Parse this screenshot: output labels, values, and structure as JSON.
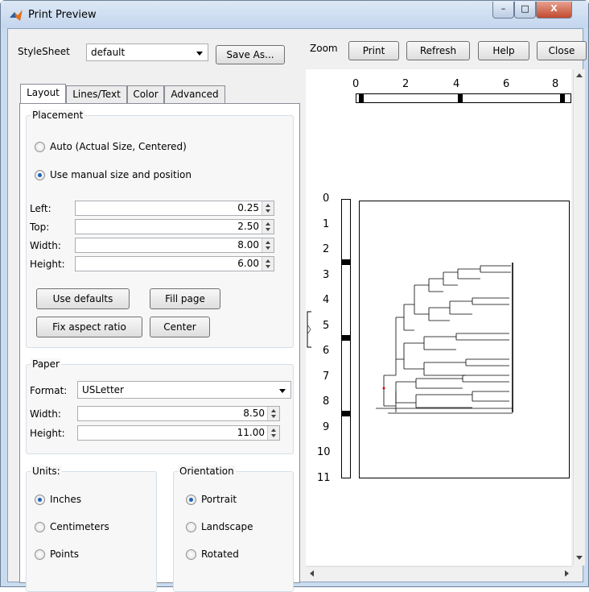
{
  "window": {
    "title": "Print Preview",
    "min": "–",
    "max": "□",
    "close": "X"
  },
  "stylesheet": {
    "label": "StyleSheet",
    "value": "default",
    "save_as": "Save As..."
  },
  "toolbar": {
    "zoom": "Zoom",
    "print": "Print",
    "refresh": "Refresh",
    "help": "Help",
    "close": "Close"
  },
  "tabs": [
    "Layout",
    "Lines/Text",
    "Color",
    "Advanced"
  ],
  "placement": {
    "title": "Placement",
    "auto": "Auto (Actual Size, Centered)",
    "manual": "Use manual size and position",
    "left_label": "Left:",
    "left": "0.25",
    "top_label": "Top:",
    "top": "2.50",
    "width_label": "Width:",
    "width": "8.00",
    "height_label": "Height:",
    "height": "6.00",
    "use_defaults": "Use defaults",
    "fill_page": "Fill page",
    "fix_aspect": "Fix aspect ratio",
    "center": "Center"
  },
  "paper": {
    "title": "Paper",
    "format_label": "Format:",
    "format": "USLetter",
    "width_label": "Width:",
    "width": "8.50",
    "height_label": "Height:",
    "height": "11.00"
  },
  "units": {
    "title": "Units:",
    "inches": "Inches",
    "cm": "Centimeters",
    "points": "Points",
    "selected": "inches"
  },
  "orientation": {
    "title": "Orientation",
    "portrait": "Portrait",
    "landscape": "Landscape",
    "rotated": "Rotated",
    "selected": "portrait"
  },
  "ruler": {
    "h_labels": [
      "0",
      "2",
      "4",
      "6",
      "8"
    ],
    "v_labels": [
      "0",
      "1",
      "2",
      "3",
      "4",
      "5",
      "6",
      "7",
      "8",
      "9",
      "10",
      "11"
    ]
  },
  "colors": {
    "accent": "#1e63b8"
  }
}
